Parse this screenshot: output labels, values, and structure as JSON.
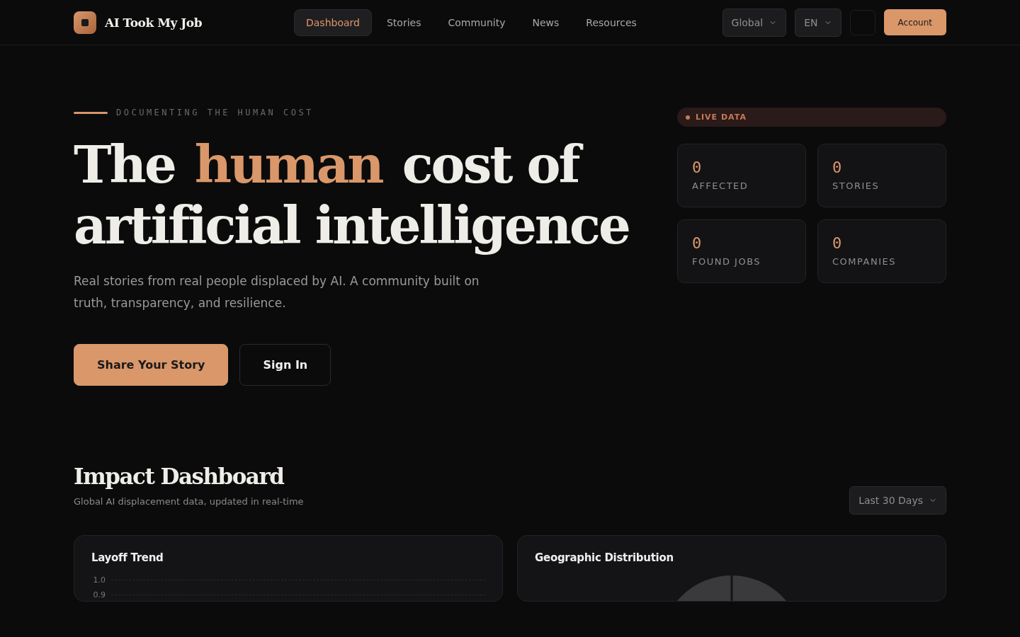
{
  "brand": {
    "name": "AI Took My Job"
  },
  "nav": [
    {
      "label": "Dashboard",
      "selected": true
    },
    {
      "label": "Stories",
      "selected": false
    },
    {
      "label": "Community",
      "selected": false
    },
    {
      "label": "News",
      "selected": false
    },
    {
      "label": "Resources",
      "selected": false
    }
  ],
  "selectors": [
    {
      "label": "Global"
    },
    {
      "label": "EN"
    }
  ],
  "account_button": "Account",
  "hero": {
    "eyebrow": "DOCUMENTING THE HUMAN COST",
    "title_lines": [
      [
        {
          "text": "The",
          "accent": false
        },
        {
          "text": "human",
          "accent": true
        },
        {
          "text": "cost of",
          "accent": false
        }
      ],
      [
        {
          "text": "artificial intelligence",
          "accent": false
        }
      ]
    ],
    "subtitle": "Real stories from real people displaced by AI. A community built on truth, transparency, and resilience.",
    "buttons": [
      {
        "label": "Share Your Story",
        "kind": "primary"
      },
      {
        "label": "Sign In",
        "kind": "secondary"
      }
    ]
  },
  "live_badge": "LIVE DATA",
  "stats": [
    {
      "value": "0",
      "label": "AFFECTED"
    },
    {
      "value": "0",
      "label": "STORIES"
    },
    {
      "value": "0",
      "label": "FOUND JOBS"
    },
    {
      "value": "0",
      "label": "COMPANIES"
    }
  ],
  "dashboard": {
    "title": "Impact Dashboard",
    "subtitle": "Global AI displacement data, updated in real-time",
    "range": "Last 30 Days",
    "cards": [
      {
        "title": "Layoff Trend",
        "kind": "line",
        "tick_labels": [
          "1.0",
          "0.9"
        ]
      },
      {
        "title": "Geographic Distribution",
        "kind": "pie"
      }
    ]
  }
}
